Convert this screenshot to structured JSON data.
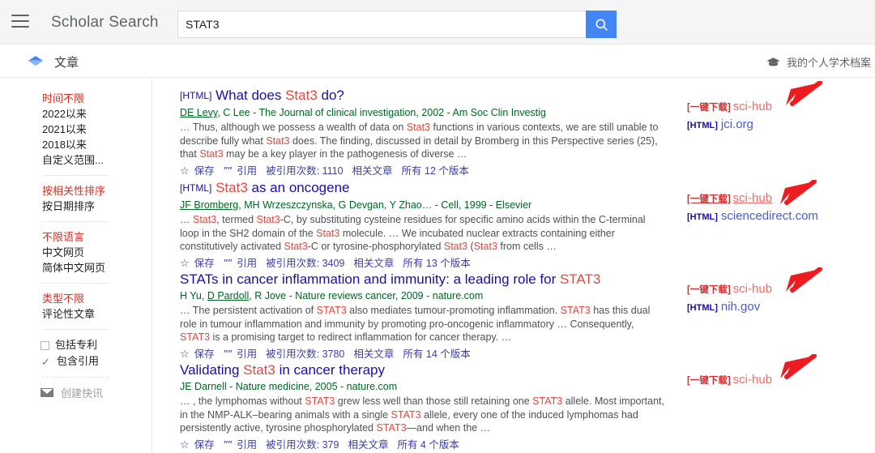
{
  "header": {
    "menu_icon": "hamburger-menu-icon",
    "brand": "Scholar Search",
    "search_value": "STAT3",
    "search_placeholder": "",
    "search_icon": "search-icon",
    "search_button_color": "#4285f4"
  },
  "subbar": {
    "scholar_icon": "scholar-diamond-icon",
    "label": "文章",
    "profile_icon": "graduation-cap-icon",
    "profile_label": "我的个人学术档案"
  },
  "sidebar": {
    "groups": [
      {
        "items": [
          {
            "label": "时间不限",
            "active": true
          },
          {
            "label": "2022以来",
            "active": false
          },
          {
            "label": "2021以来",
            "active": false
          },
          {
            "label": "2018以来",
            "active": false
          },
          {
            "label": "自定义范围...",
            "active": false
          }
        ]
      },
      {
        "items": [
          {
            "label": "按相关性排序",
            "active": true
          },
          {
            "label": "按日期排序",
            "active": false
          }
        ]
      },
      {
        "items": [
          {
            "label": "不限语言",
            "active": true
          },
          {
            "label": "中文网页",
            "active": false
          },
          {
            "label": "简体中文网页",
            "active": false
          }
        ]
      },
      {
        "items": [
          {
            "label": "类型不限",
            "active": true
          },
          {
            "label": "评论性文章",
            "active": false
          }
        ]
      }
    ],
    "checkboxes": [
      {
        "label": "包括专利",
        "checked": false
      },
      {
        "label": "包含引用",
        "checked": true
      }
    ],
    "alert": {
      "icon": "envelope-icon",
      "label": "创建快讯"
    }
  },
  "results": [
    {
      "tag": "[HTML]",
      "title_parts": [
        {
          "t": "What does ",
          "hl": false
        },
        {
          "t": "Stat3",
          "hl": true
        },
        {
          "t": " do?",
          "hl": false
        }
      ],
      "authors_underlined": "DE Levy",
      "authors_rest": ", C Lee - The Journal of clinical investigation, 2002 - Am Soc Clin Investig",
      "snippet_parts": [
        {
          "t": "… Thus, although we possess a wealth of data on ",
          "hl": false
        },
        {
          "t": "Stat3",
          "hl": true
        },
        {
          "t": " functions in various contexts, we are still unable to describe fully what ",
          "hl": false
        },
        {
          "t": "Stat3",
          "hl": true
        },
        {
          "t": " does. The finding, discussed in detail by Bromberg in this Perspective series (25), that ",
          "hl": false
        },
        {
          "t": "Stat3",
          "hl": true
        },
        {
          "t": " may be a key player in the pathogenesis of diverse …",
          "hl": false
        }
      ],
      "save": "保存",
      "cite": "引用",
      "cited_by": "被引用次数: 1110",
      "related": "相关文章",
      "versions": "所有 12 个版本"
    },
    {
      "tag": "[HTML]",
      "title_parts": [
        {
          "t": "Stat3",
          "hl": true
        },
        {
          "t": " as an oncogene",
          "hl": false
        }
      ],
      "authors_underlined": "JF Bromberg",
      "authors_rest": ", MH Wrzeszczynska, G Devgan, Y Zhao… - Cell, 1999 - Elsevier",
      "snippet_parts": [
        {
          "t": "… ",
          "hl": false
        },
        {
          "t": "Stat3",
          "hl": true
        },
        {
          "t": ", termed ",
          "hl": false
        },
        {
          "t": "Stat3",
          "hl": true
        },
        {
          "t": "-C, by substituting cysteine residues for specific amino acids within the C-terminal loop in the SH2 domain of the ",
          "hl": false
        },
        {
          "t": "Stat3",
          "hl": true
        },
        {
          "t": " molecule. … We incubated nuclear extracts containing either constitutively activated ",
          "hl": false
        },
        {
          "t": "Stat3",
          "hl": true
        },
        {
          "t": "-C or tyrosine-phosphorylated ",
          "hl": false
        },
        {
          "t": "Stat3",
          "hl": true
        },
        {
          "t": " (",
          "hl": false
        },
        {
          "t": "Stat3",
          "hl": true
        },
        {
          "t": " from cells …",
          "hl": false
        }
      ],
      "save": "保存",
      "cite": "引用",
      "cited_by": "被引用次数: 3409",
      "related": "相关文章",
      "versions": "所有 13 个版本"
    },
    {
      "tag": "",
      "title_parts": [
        {
          "t": "STATs in cancer inflammation and immunity: a leading role for ",
          "hl": false
        },
        {
          "t": "STAT3",
          "hl": true
        }
      ],
      "authors_underlined": "D Pardoll",
      "authors_prefix": "H Yu, ",
      "authors_rest": ", R Jove - Nature reviews cancer, 2009 - nature.com",
      "snippet_parts": [
        {
          "t": "… The persistent activation of ",
          "hl": false
        },
        {
          "t": "STAT3",
          "hl": true
        },
        {
          "t": " also mediates tumour-promoting inflammation. ",
          "hl": false
        },
        {
          "t": "STAT3",
          "hl": true
        },
        {
          "t": " has this dual role in tumour inflammation and immunity by promoting pro-oncogenic inflammatory … Consequently, ",
          "hl": false
        },
        {
          "t": "STAT3",
          "hl": true
        },
        {
          "t": " is a promising target to redirect inflammation for cancer therapy. …",
          "hl": false
        }
      ],
      "save": "保存",
      "cite": "引用",
      "cited_by": "被引用次数: 3780",
      "related": "相关文章",
      "versions": "所有 14 个版本"
    },
    {
      "tag": "",
      "title_parts": [
        {
          "t": "Validating ",
          "hl": false
        },
        {
          "t": "Stat3",
          "hl": true
        },
        {
          "t": " in cancer therapy",
          "hl": false
        }
      ],
      "authors_underlined": "",
      "authors_prefix": "JE Darnell - Nature medicine, 2005 - nature.com",
      "authors_rest": "",
      "snippet_parts": [
        {
          "t": "… , the lymphomas without ",
          "hl": false
        },
        {
          "t": "STAT3",
          "hl": true
        },
        {
          "t": " grew less well than those still retaining one ",
          "hl": false
        },
        {
          "t": "STAT3",
          "hl": true
        },
        {
          "t": " allele. Most important, in the NMP-ALK–bearing animals with a single ",
          "hl": false
        },
        {
          "t": "STAT3",
          "hl": true
        },
        {
          "t": " allele, every one of the induced lymphomas had persistently active, tyrosine phosphorylated ",
          "hl": false
        },
        {
          "t": "STAT3",
          "hl": true
        },
        {
          "t": "—and when the …",
          "hl": false
        }
      ],
      "save": "保存",
      "cite": "引用",
      "cited_by": "被引用次数: 379",
      "related": "相关文章",
      "versions": "所有 4 个版本"
    }
  ],
  "right_links": [
    {
      "scihub_tag": "[一键下载]",
      "scihub_name": "sci-hub",
      "hover": false,
      "html_tag": "[HTML]",
      "html_name": "jci.org",
      "has_html": true
    },
    {
      "scihub_tag": "[一键下载]",
      "scihub_name": "sci-hub",
      "hover": true,
      "html_tag": "[HTML]",
      "html_name": "sciencedirect.com",
      "has_html": true
    },
    {
      "scihub_tag": "[一键下载]",
      "scihub_name": "sci-hub",
      "hover": false,
      "html_tag": "[HTML]",
      "html_name": "nih.gov",
      "has_html": true
    },
    {
      "scihub_tag": "[一键下载]",
      "scihub_name": "sci-hub",
      "hover": false,
      "html_tag": "",
      "html_name": "",
      "has_html": false
    }
  ],
  "annotations": {
    "arrow_color": "#ee1c20",
    "arrow_name": "red-annotation-arrow"
  }
}
